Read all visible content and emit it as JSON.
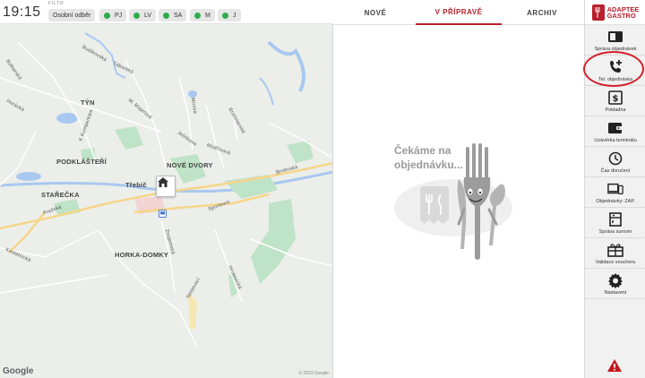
{
  "header": {
    "time": "19:15",
    "filter_label": "FILTR",
    "chips": [
      {
        "label": "Osobní odběr",
        "dot": false
      },
      {
        "label": "PJ",
        "dot": true
      },
      {
        "label": "LV",
        "dot": true
      },
      {
        "label": "SA",
        "dot": true
      },
      {
        "label": "M",
        "dot": true
      },
      {
        "label": "J",
        "dot": true
      }
    ]
  },
  "tabs": [
    {
      "label": "NOVÉ",
      "active": false
    },
    {
      "label": "V PŘÍPRAVĚ",
      "active": true
    },
    {
      "label": "ARCHIV",
      "active": false
    }
  ],
  "empty_state": {
    "line1": "Čekáme na",
    "line2": "objednávku..."
  },
  "brand": {
    "line1": "ADAPTEE",
    "line2": "GASTRO"
  },
  "sidebar": {
    "items": [
      {
        "label": "Správa objednávek",
        "icon": "book-icon"
      },
      {
        "label": "Tel. objednávka",
        "icon": "phone-plus-icon"
      },
      {
        "label": "Pokladna",
        "icon": "cash-register-icon"
      },
      {
        "label": "Uzávěrka terminálu",
        "icon": "wallet-icon"
      },
      {
        "label": "Čas doručení",
        "icon": "clock-icon"
      },
      {
        "label": "Objednávky: ZAP.",
        "icon": "devices-icon"
      },
      {
        "label": "Správa surovin",
        "icon": "pantry-icon"
      },
      {
        "label": "Validace voucheru",
        "icon": "gift-icon"
      },
      {
        "label": "Nastavení",
        "icon": "gear-icon"
      }
    ]
  },
  "map": {
    "labels": {
      "tyn": "TÝN",
      "podklasteri": "PODKLÁŠTEŘÍ",
      "nove_dvory": "NOVÉ DVORY",
      "trebic": "Třebíč",
      "starecka": "STAŘEČKA",
      "horka_domky": "HORKA-DOMKY",
      "budikovska": "Budíkovská",
      "taborska": "Táborská",
      "m_majerove": "M. Majerové",
      "mirova": "Mírová",
      "jelinkova": "Jelínkova",
      "modrinova": "Modřínová",
      "bratislavska": "Bratislavská",
      "brnenska": "Brněnská",
      "sportovni": "Sportovní",
      "znojemska": "Znojemská",
      "spojovaci": "Spojovací",
      "hrotovicka": "Hrotovická",
      "kostelnicka": "Kostelnická",
      "pozadka": "Pražská",
      "horacka": "Horácká",
      "bulharska": "Bulharská",
      "kumperky": "K Kumperkám",
      "google": "Google",
      "copyright": "© 2023 Google"
    },
    "colors": {
      "water": "#a9c8f0",
      "park": "#bfe3c7",
      "road_major": "#f6d589",
      "road_minor": "#ffffff"
    }
  },
  "colors": {
    "accent": "#b8202b",
    "status_green": "#2eac4c",
    "warning": "#c4161c"
  }
}
